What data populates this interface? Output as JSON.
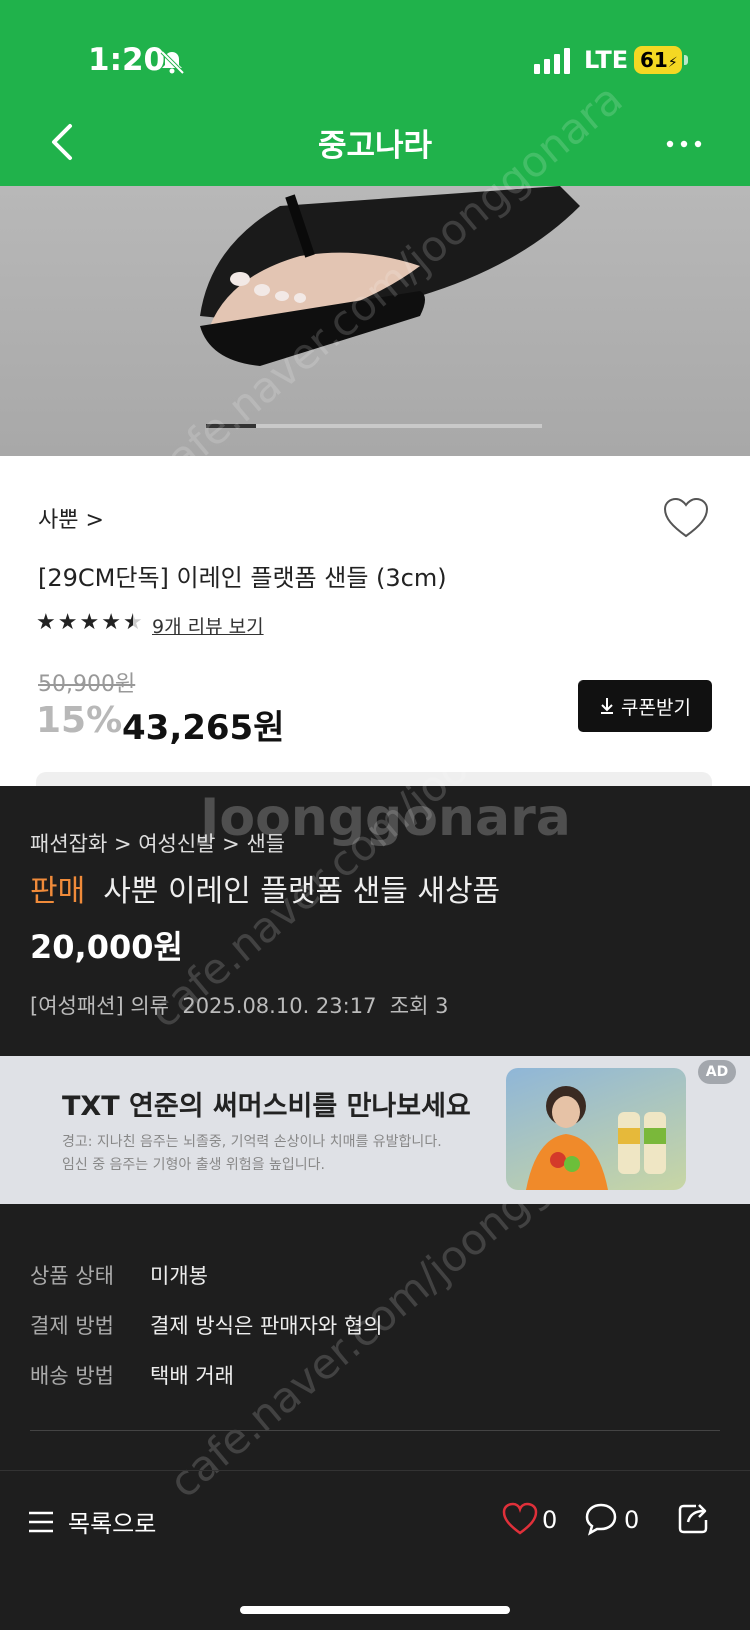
{
  "status_bar": {
    "time": "1:20",
    "network": "LTE",
    "battery": "61"
  },
  "header": {
    "title": "중고나라"
  },
  "product_image": {
    "carousel_position": 0.15
  },
  "product": {
    "brand": "사뿐 >",
    "name": "[29CM단독] 이레인 플랫폼 샌들 (3cm)",
    "rating": 4.5,
    "review_link": "9개 리뷰 보기",
    "original_price": "50,900원",
    "discount": "15%",
    "price": "43,265원",
    "coupon_button": "쿠폰받기"
  },
  "listing": {
    "watermark": "Joonggonara",
    "breadcrumb": "패션잡화 > 여성신발 > 샌들",
    "status": "판매",
    "title": "사뿐 이레인 플랫폼 샌들 새상품",
    "price": "20,000원",
    "meta": "[여성패션] 의류  2025.08.10. 23:17  조회 3"
  },
  "ad": {
    "title": "TXT 연준의 써머스비를 만나보세요",
    "warning_line1": "경고: 지나친 음주는 뇌졸중, 기억력 손상이나 치매를 유발합니다.",
    "warning_line2": "임신 중 음주는 기형아 출생 위험을 높입니다.",
    "badge": "AD"
  },
  "details": [
    {
      "label": "상품 상태",
      "value": "미개봉"
    },
    {
      "label": "결제 방법",
      "value": "결제 방식은 판매자와 협의"
    },
    {
      "label": "배송 방법",
      "value": "택배 거래"
    }
  ],
  "bottom_bar": {
    "list_label": "목록으로",
    "like_count": "0",
    "comment_count": "0"
  },
  "colors": {
    "header_green": "#20b24b",
    "sale_orange": "#f08b3a",
    "dark_bg": "#1e1e1e",
    "heart_red": "#e0303a"
  }
}
